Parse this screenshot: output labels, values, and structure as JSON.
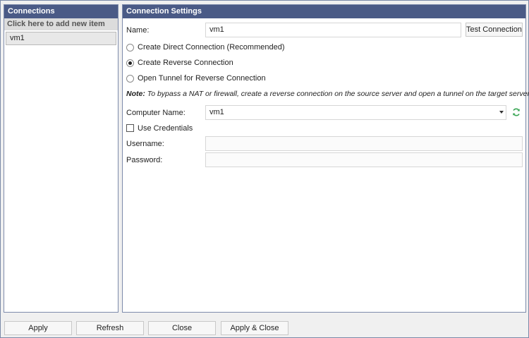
{
  "left": {
    "header": "Connections",
    "add_item": "Click here to add new item",
    "items": [
      "vm1"
    ]
  },
  "right": {
    "header": "Connection Settings",
    "name_label": "Name:",
    "name_value": "vm1",
    "test_button": "Test Connection",
    "options": [
      {
        "label": "Create Direct Connection (Recommended)",
        "selected": false
      },
      {
        "label": "Create Reverse Connection",
        "selected": true
      },
      {
        "label": "Open Tunnel for Reverse Connection",
        "selected": false
      }
    ],
    "note_prefix": "Note:",
    "note_text": " To bypass a NAT or firewall, create a reverse connection on the source server and open a tunnel on the target server.",
    "computer_label": "Computer Name:",
    "computer_value": "vm1",
    "use_credentials": "Use Credentials",
    "use_credentials_checked": false,
    "username_label": "Username:",
    "username_value": "",
    "password_label": "Password:",
    "password_value": ""
  },
  "footer": {
    "apply": "Apply",
    "refresh": "Refresh",
    "close": "Close",
    "apply_close": "Apply & Close"
  },
  "colors": {
    "header_bg": "#4a5a86",
    "refresh_icon": "#3aa655"
  },
  "icons": {
    "refresh": "refresh-icon",
    "dropdown": "chevron-down-icon"
  }
}
